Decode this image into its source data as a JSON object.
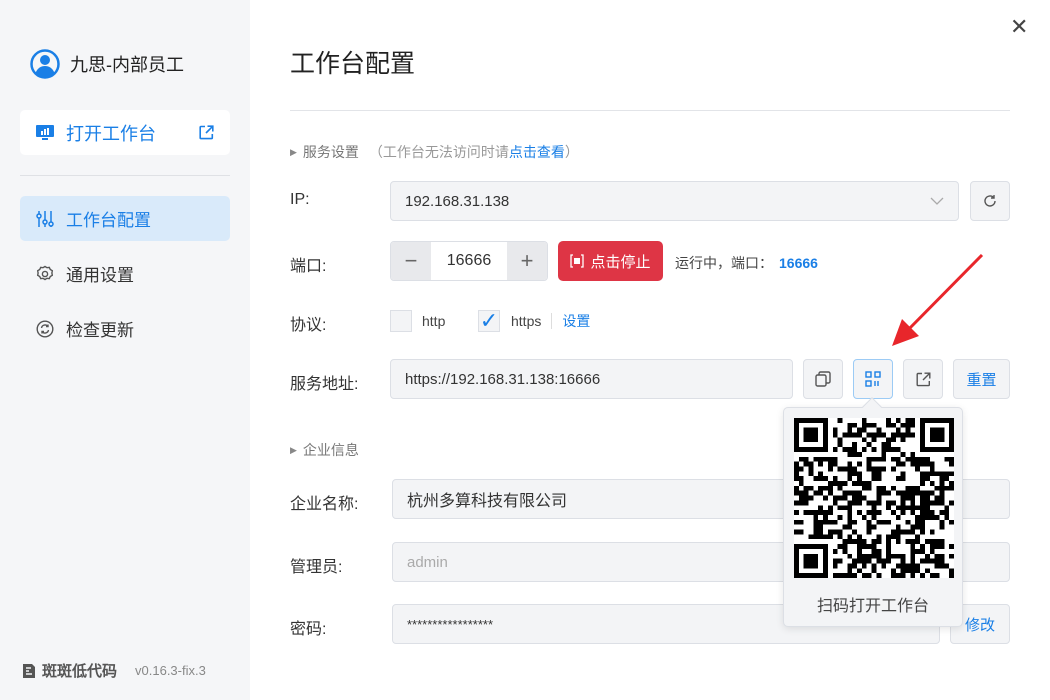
{
  "sidebar": {
    "user": "九思-内部员工",
    "open_workbench": "打开工作台",
    "items": [
      {
        "label": "工作台配置"
      },
      {
        "label": "通用设置"
      },
      {
        "label": "检查更新"
      }
    ],
    "brand": "斑斑低代码",
    "version": "v0.16.3-fix.3"
  },
  "main": {
    "title": "工作台配置",
    "service": {
      "section": "服务设置",
      "hint_prefix": "（工作台无法访问时请",
      "hint_link": "点击查看",
      "hint_suffix": "）",
      "ip_label": "IP:",
      "ip_value": "192.168.31.138",
      "port_label": "端口:",
      "port_value": "16666",
      "stop_label": "点击停止",
      "status_prefix": "运行中，端口：",
      "status_port": "16666",
      "protocol_label": "协议:",
      "http": "http",
      "https": "https",
      "https_checked": true,
      "http_checked": false,
      "settings_link": "设置",
      "address_label": "服务地址:",
      "address_value": "https://192.168.31.138:16666",
      "reset_label": "重置"
    },
    "enterprise": {
      "section": "企业信息",
      "name_label": "企业名称:",
      "name_value": "杭州多算科技有限公司",
      "admin_label": "管理员:",
      "admin_placeholder": "admin",
      "password_label": "密码:",
      "password_value": "*****************",
      "modify_label": "修改"
    },
    "qr_popup": {
      "caption": "扫码打开工作台"
    }
  },
  "colors": {
    "accent": "#1a7fe6",
    "danger": "#de3545",
    "arrow": "#e8262b"
  }
}
